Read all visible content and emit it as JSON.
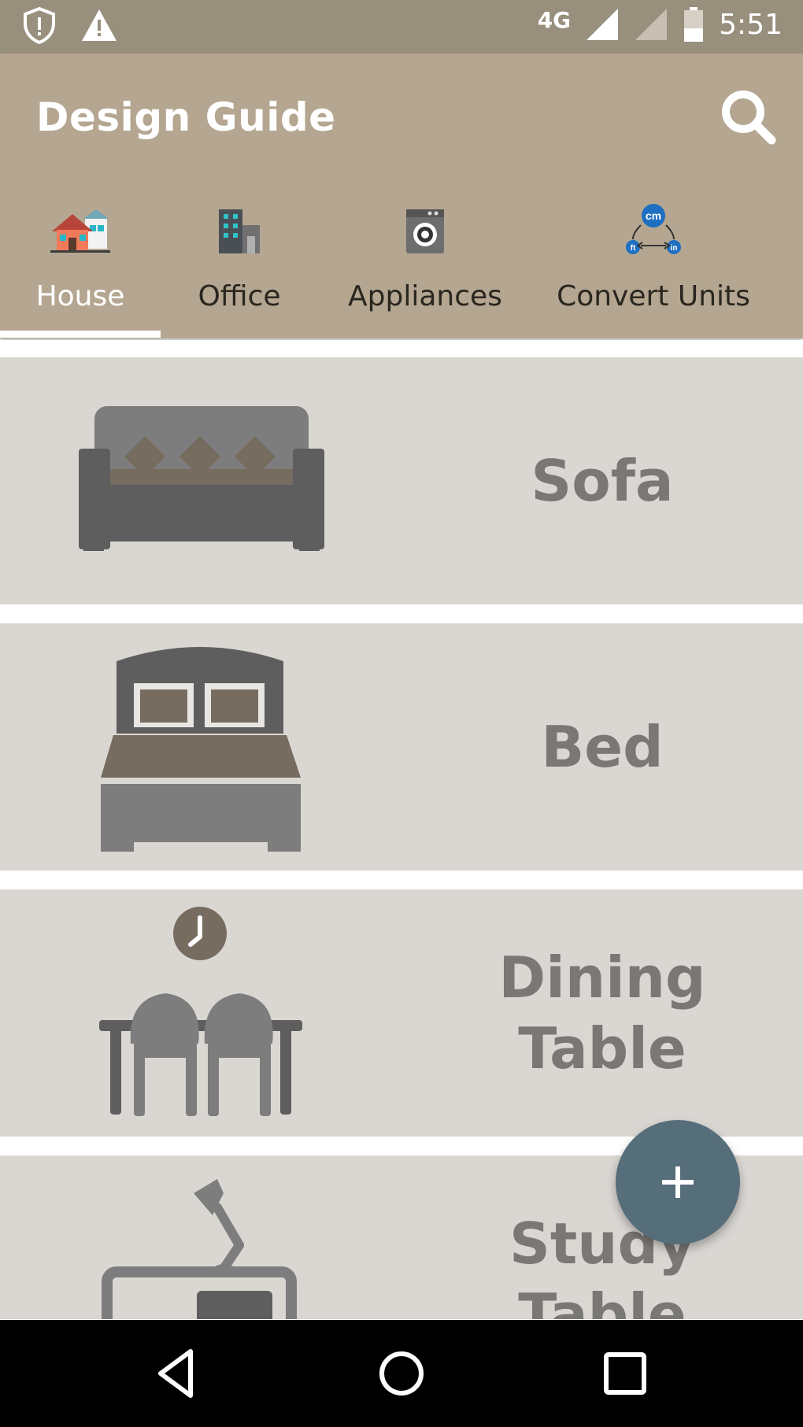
{
  "status_bar": {
    "network": "4G",
    "time": "5:51"
  },
  "app_bar": {
    "title": "Design Guide"
  },
  "tabs": [
    {
      "label": "House",
      "icon": "house-icon",
      "active": true
    },
    {
      "label": "Office",
      "icon": "office-building-icon",
      "active": false
    },
    {
      "label": "Appliances",
      "icon": "washing-machine-icon",
      "active": false
    },
    {
      "label": "Convert Units",
      "icon": "convert-units-icon",
      "active": false
    }
  ],
  "items": [
    {
      "label": "Sofa",
      "icon": "sofa-icon"
    },
    {
      "label": "Bed",
      "icon": "bed-icon"
    },
    {
      "label": "Dining Table",
      "icon": "dining-table-icon"
    },
    {
      "label": "Study Table",
      "icon": "study-table-icon"
    }
  ],
  "units_icon": {
    "top": "cm",
    "left": "ft",
    "right": "in"
  },
  "colors": {
    "status_bar": "#998f7d",
    "app_bar": "#b4a690",
    "card": "#dad7d3",
    "card_text": "#7a7875",
    "fab": "#566d7a"
  }
}
